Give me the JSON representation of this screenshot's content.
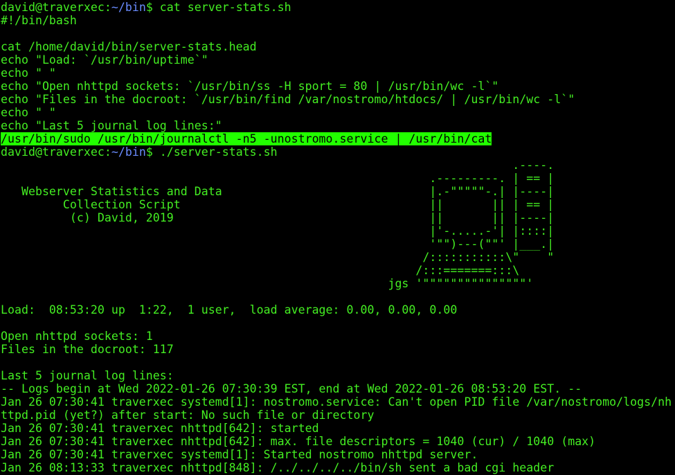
{
  "colors": {
    "background": "#000000",
    "foreground": "#44ee22",
    "highlight_bg": "#22ff00",
    "path": "#6a8cff"
  },
  "prompts": [
    {
      "user_host": "david@traverxec",
      "sep": ":",
      "path": "~/bin",
      "symbol": "$",
      "command": " cat server-stats.sh"
    },
    {
      "user_host": "david@traverxec",
      "sep": ":",
      "path": "~/bin",
      "symbol": "$",
      "command": " ./server-stats.sh"
    }
  ],
  "script_lines": [
    "#!/bin/bash",
    "",
    "cat /home/david/bin/server-stats.head",
    "echo \"Load: `/usr/bin/uptime`\"",
    "echo \" \"",
    "echo \"Open nhttpd sockets: `/usr/bin/ss -H sport = 80 | /usr/bin/wc -l`\"",
    "echo \"Files in the docroot: `/usr/bin/find /var/nostromo/htdocs/ | /usr/bin/wc -l`\"",
    "echo \" \"",
    "echo \"Last 5 journal log lines:\""
  ],
  "highlighted_line": "/usr/bin/sudo /usr/bin/journalctl -n5 -unostromo.service | /usr/bin/cat",
  "banner_lines": [
    "                                                                          .----.",
    "                                                              .---------. | == |",
    "   Webserver Statistics and Data                              |.-\"\"\"\"\"-.| |----|",
    "         Collection Script                                    ||       || | == |",
    "          (c) David, 2019                                     ||       || |----|",
    "                                                              |'-.....-'| |::::|",
    "                                                              '\"\")---(\"\"' |___.|",
    "                                                             /:::::::::::\\\"    \"",
    "                                                            /:::=======:::\\",
    "                                                        jgs '\"\"\"\"\"\"\"\"\"\"\"\"\"\"\"'"
  ],
  "output_lines": [
    "",
    "Load:  08:53:20 up  1:22,  1 user,  load average: 0.00, 0.00, 0.00",
    "",
    "Open nhttpd sockets: 1",
    "Files in the docroot: 117",
    "",
    "Last 5 journal log lines:",
    "-- Logs begin at Wed 2022-01-26 07:30:39 EST, end at Wed 2022-01-26 08:53:20 EST. --",
    "Jan 26 07:30:41 traverxec systemd[1]: nostromo.service: Can't open PID file /var/nostromo/logs/nh",
    "ttpd.pid (yet?) after start: No such file or directory",
    "Jan 26 07:30:41 traverxec nhttpd[642]: started",
    "Jan 26 07:30:41 traverxec nhttpd[642]: max. file descriptors = 1040 (cur) / 1040 (max)",
    "Jan 26 07:30:41 traverxec systemd[1]: Started nostromo nhttpd server.",
    "Jan 26 08:13:33 traverxec nhttpd[848]: /../../../../bin/sh sent a bad cgi header"
  ]
}
